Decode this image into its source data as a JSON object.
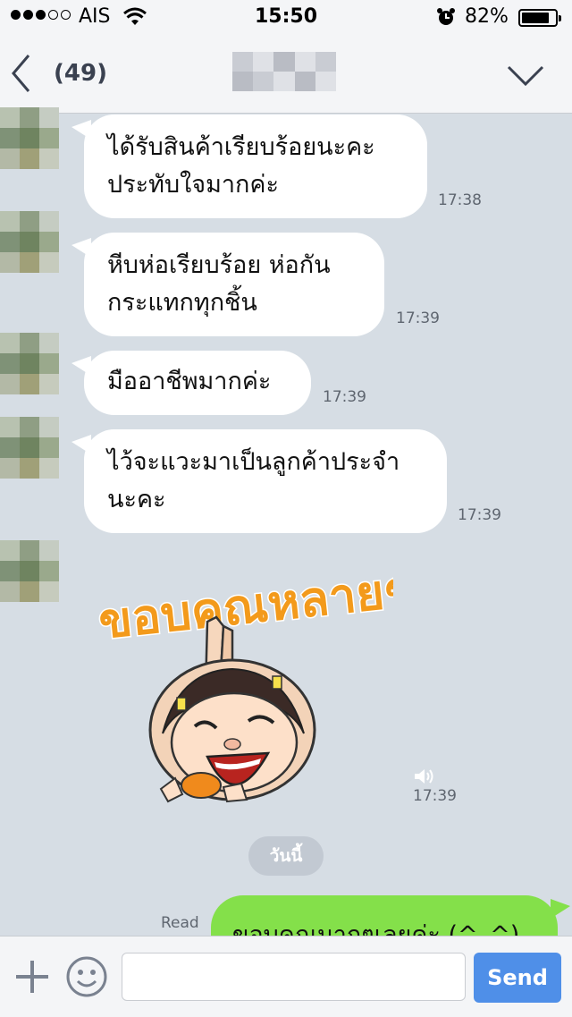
{
  "status_bar": {
    "signal_dots_filled": 3,
    "signal_dots_total": 5,
    "carrier": "AIS",
    "time": "15:50",
    "battery_percent": "82%",
    "battery_level": 0.82
  },
  "header": {
    "back_count": "(49)"
  },
  "messages": [
    {
      "line1": "ได้รับสินค้าเรียบร้อยนะคะ",
      "line2": "ประทับใจมากค่ะ",
      "time": "17:38"
    },
    {
      "line1": "หีบห่อเรียบร้อย ห่อกัน",
      "line2": "กระแทกทุกชิ้น",
      "time": "17:39"
    },
    {
      "line1": "มืออาชีพมากค่ะ",
      "time": "17:39"
    },
    {
      "line1": "ไว้จะแวะมาเป็นลูกค้าประจำ",
      "line2": "นะคะ",
      "time": "17:39"
    }
  ],
  "sticker": {
    "text": "ขอบคุณหลายๆ",
    "time": "17:39",
    "icon": "speaker-icon"
  },
  "date_divider": "วันนี้",
  "outgoing": {
    "read_label": "Read",
    "text": "ขอบคุณมากๆเลยค่ะ (^_^)"
  },
  "input_bar": {
    "send_label": "Send",
    "plus_icon": "plus-icon",
    "emoji_icon": "smiley-icon"
  },
  "colors": {
    "chat_background": "#d6dde4",
    "outgoing_bubble": "#84e04a",
    "send_button": "#4f8fe8",
    "sticker_text": "#f39a1b"
  }
}
